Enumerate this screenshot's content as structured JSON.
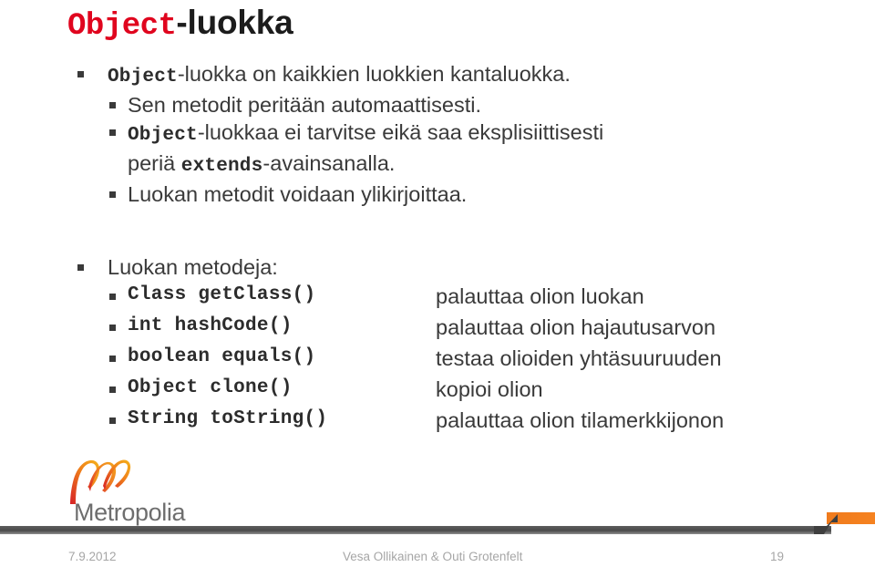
{
  "slide": {
    "title_code": "Object",
    "title_plain": "-luokka",
    "bullets": [
      {
        "level": 1,
        "code_prefix": "Object",
        "text": "-luokka on kaikkien luokkien kantaluokka."
      },
      {
        "level": 2,
        "code_prefix": "",
        "text": "Sen metodit peritään automaattisesti."
      },
      {
        "level": 2,
        "code_prefix": "Object",
        "text": "-luokkaa ei tarvitse eikä saa eksplisiittisesti"
      },
      {
        "level": 2,
        "continuation": true,
        "text_before": "periä ",
        "code_mid": "extends",
        "text_after": "-avainsanalla."
      },
      {
        "level": 2,
        "code_prefix": "",
        "text": "Luokan metodit voidaan ylikirjoittaa."
      }
    ],
    "methods_heading": "Luokan metodeja:",
    "methods": [
      {
        "signature": "Class getClass()",
        "description": "palauttaa olion luokan"
      },
      {
        "signature": "int hashCode()",
        "description": "palauttaa olion hajautusarvon"
      },
      {
        "signature": "boolean equals()",
        "description": "testaa olioiden yhtäsuuruuden"
      },
      {
        "signature": "Object clone()",
        "description": "kopioi olion"
      },
      {
        "signature": "String toString()",
        "description": "palauttaa olion tilamerkkijonon"
      }
    ]
  },
  "logo": {
    "wordmark": "Metropolia",
    "mark_name": "metropolia-m-swoosh-icon",
    "colors": {
      "red": "#d62027",
      "orange": "#ef7d1a",
      "yellow": "#f5b31b",
      "wordmark_gray": "#6e6e6e"
    }
  },
  "footer": {
    "date": "7.9.2012",
    "authors": "Vesa Ollikainen & Outi Grotenfelt",
    "page_number": "19",
    "accent_orange": "#f58220",
    "bar_gray": "#4a4a4a"
  }
}
